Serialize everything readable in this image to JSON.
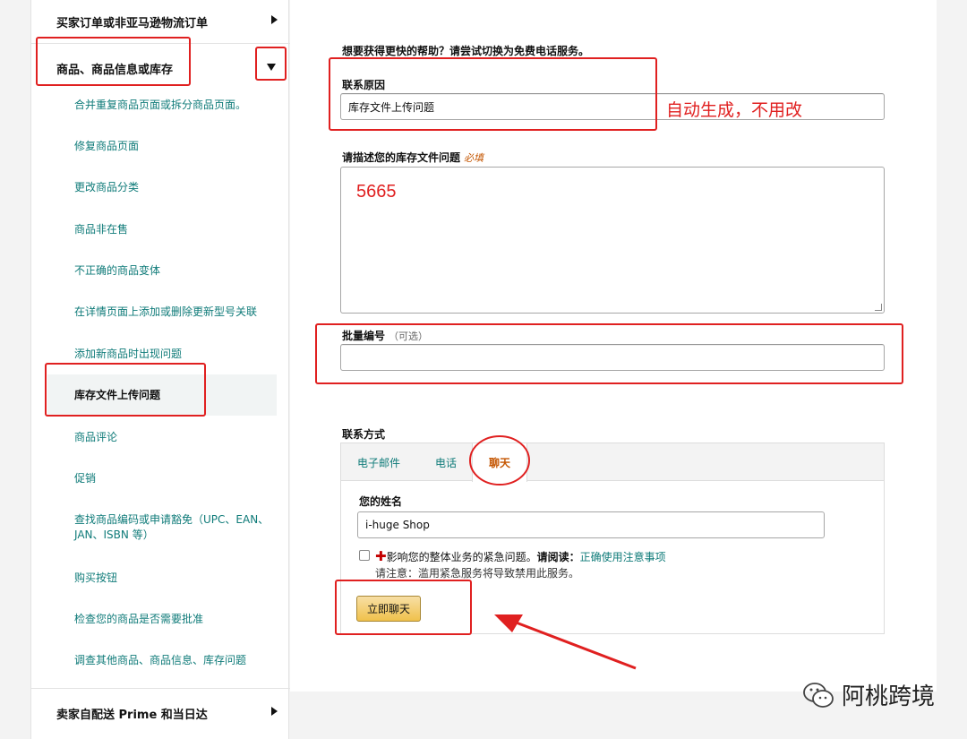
{
  "sidebar": {
    "section_top": "买家订单或非亚马逊物流订单",
    "section_current": "商品、商品信息或库存",
    "items": [
      "合并重复商品页面或拆分商品页面。",
      "修复商品页面",
      "更改商品分类",
      "商品非在售",
      "不正确的商品变体",
      "在详情页面上添加或删除更新型号关联",
      "添加新商品时出现问题",
      "库存文件上传问题",
      "商品评论",
      "促销",
      "查找商品编码或申请豁免（UPC、EAN、JAN、ISBN 等）",
      "购买按钮",
      "检查您的商品是否需要批准",
      "调查其他商品、商品信息、库存问题"
    ],
    "section_bottom": "卖家自配送 Prime 和当日达"
  },
  "form": {
    "help_text": "想要获得更快的帮助？请尝试切换为免费电话服务。",
    "reason_label": "联系原因",
    "reason_value": "库存文件上传问题",
    "describe_label": "请描述您的库存文件问题",
    "required_tag": "必填",
    "describe_value": "5665",
    "batch_label": "批量编号",
    "optional_tag": "（可选）",
    "contact_label": "联系方式",
    "tabs": [
      "电子邮件",
      "电话",
      "聊天"
    ],
    "name_label": "您的姓名",
    "name_value": "i-huge Shop",
    "urgent_text": "影响您的整体业务的紧急问题。",
    "read_label": "请阅读：",
    "read_link": "正确使用注意事项",
    "notice": "请注意：滥用紧急服务将导致禁用此服务。",
    "chat_button": "立即聊天"
  },
  "annotations": {
    "auto_note": "自动生成，不用改",
    "accent_color": "#e02020"
  },
  "watermark": {
    "text": "阿桃跨境"
  }
}
